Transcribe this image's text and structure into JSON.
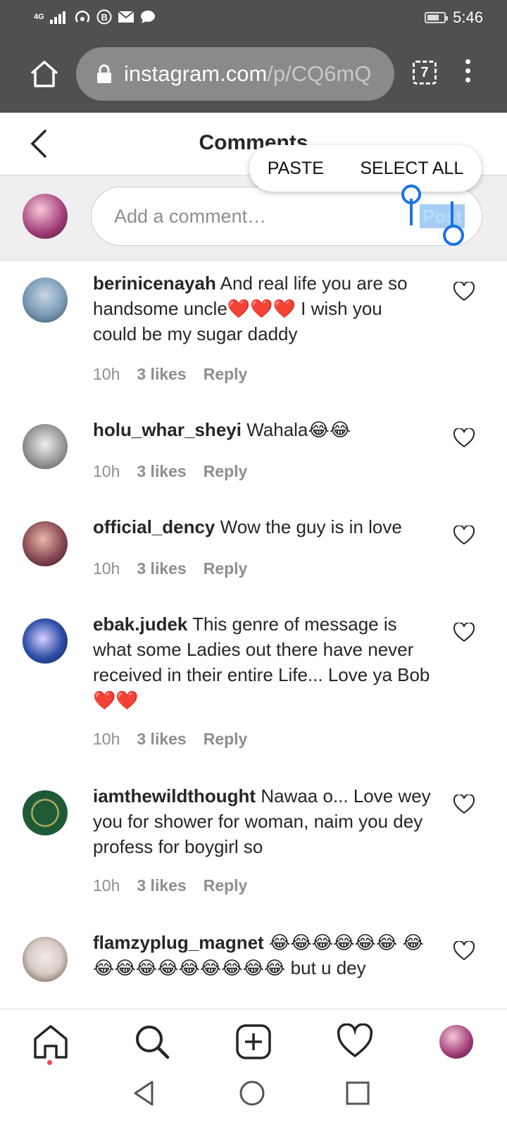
{
  "status_bar": {
    "network": "4G",
    "time": "5:46"
  },
  "browser": {
    "url_domain": "instagram.com",
    "url_path": "/p/CQ6mQ",
    "tab_count": "7"
  },
  "header": {
    "title": "Comments"
  },
  "context_menu": {
    "paste": "PASTE",
    "select_all": "SELECT ALL"
  },
  "composer": {
    "placeholder": "Add a comment…",
    "post_label": "Post"
  },
  "comments": [
    {
      "username": "berinicenayah",
      "text": "And real life you are so handsome uncle❤️❤️❤️ I wish you could be my sugar daddy",
      "time": "10h",
      "likes": "3 likes",
      "reply": "Reply",
      "avatar_color": "#7a9bb8"
    },
    {
      "username": "holu_whar_sheyi",
      "text": "Wahala😂😂",
      "time": "10h",
      "likes": "3 likes",
      "reply": "Reply",
      "avatar_color": "#9a9a9a"
    },
    {
      "username": "official_dency",
      "text": "Wow the guy is in love",
      "time": "10h",
      "likes": "3 likes",
      "reply": "Reply",
      "avatar_color": "#8a4a55"
    },
    {
      "username": "ebak.judek",
      "text": "This genre of message is what some Ladies out there have never received in their entire Life... Love ya Bob❤️❤️",
      "time": "10h",
      "likes": "3 likes",
      "reply": "Reply",
      "avatar_color": "#2f4fa8"
    },
    {
      "username": "iamthewildthought",
      "text": "Nawaa o... Love wey you for shower for woman, naim you dey profess for boygirl so",
      "time": "10h",
      "likes": "3 likes",
      "reply": "Reply",
      "avatar_color": "#1f5a36"
    },
    {
      "username": "flamzyplug_magnet",
      "text": "😂😂😂😂😂😂 😂😂😂😂😂😂😂😂😂😂 but u dey",
      "time": "",
      "likes": "",
      "reply": "",
      "avatar_color": "#d8ccc4"
    }
  ]
}
